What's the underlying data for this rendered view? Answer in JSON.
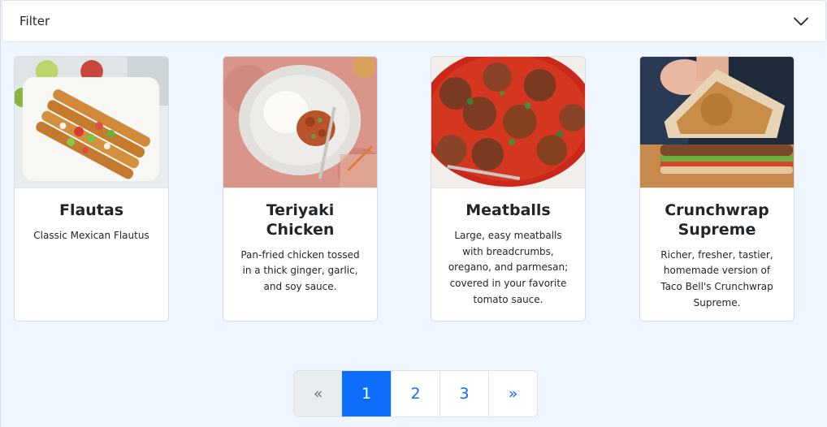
{
  "filter": {
    "label": "Filter",
    "expanded": false
  },
  "cards": [
    {
      "title": "Flautas",
      "description": "Classic Mexican Flautus",
      "image": "flautas-photo"
    },
    {
      "title": "Teriyaki Chicken",
      "description": "Pan-fried chicken tossed in a thick ginger, garlic, and soy sauce.",
      "image": "teriyaki-chicken-photo"
    },
    {
      "title": "Meatballs",
      "description": "Large, easy meatballs with breadcrumbs, oregano, and parmesan; covered in your favorite tomato sauce.",
      "image": "meatballs-photo"
    },
    {
      "title": "Crunchwrap Supreme",
      "description": "Richer, fresher, tastier, homemade version of Taco Bell's Crunchwrap Supreme.",
      "image": "crunchwrap-photo"
    }
  ],
  "pagination": {
    "prev": "«",
    "pages": [
      "1",
      "2",
      "3"
    ],
    "next": "»",
    "current": "1",
    "prev_disabled": true
  },
  "colors": {
    "page_background": "#f0f6ff",
    "accent": "#0d6efd",
    "card_border": "#d9dde2"
  }
}
